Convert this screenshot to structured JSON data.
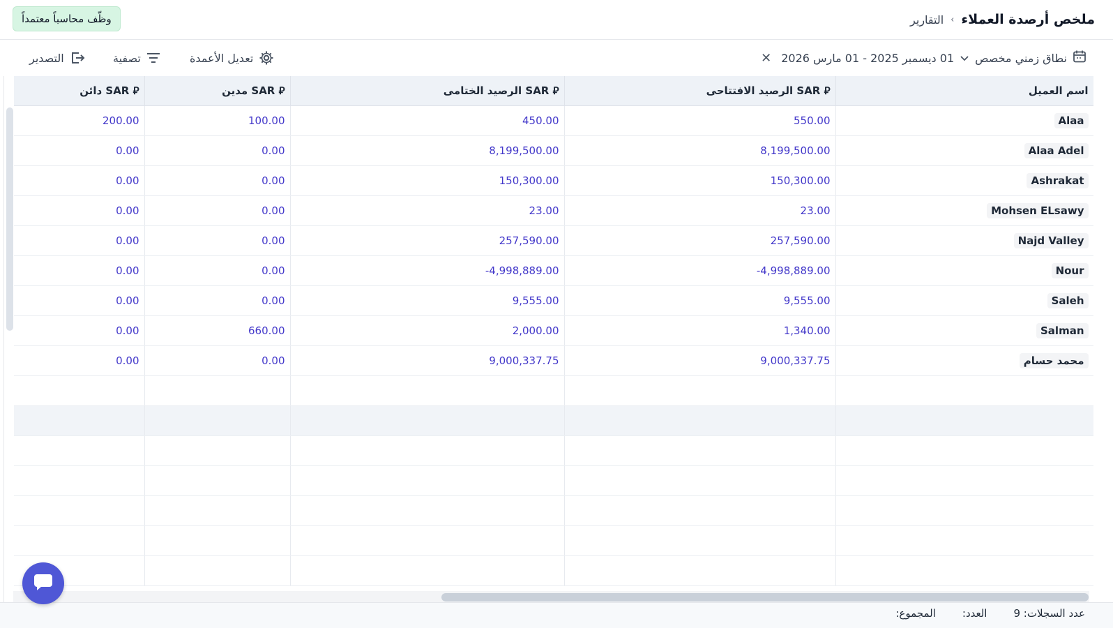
{
  "breadcrumb": {
    "parent": "التقارير",
    "separator": "›",
    "title": "ملخص أرصدة العملاء"
  },
  "cta_label": "وظّف محاسباً معتمداً",
  "toolbar": {
    "date_range_label": "نطاق زمني مخصص",
    "date_range_value": "01 ديسمبر 2025 - 01 مارس 2026",
    "edit_columns": "تعديل الأعمدة",
    "filter": "تصفية",
    "export": "التصدير"
  },
  "columns": {
    "customer": "اسم العميل",
    "opening": "الرصيد الافتتاحى SAR ⃁",
    "closing": "الرصيد الختامى SAR ⃁",
    "debit": "مدين SAR ⃁",
    "credit": "دائن SAR ⃁"
  },
  "rows": [
    {
      "name": "Alaa",
      "opening": "550.00",
      "closing": "450.00",
      "debit": "100.00",
      "credit": "200.00"
    },
    {
      "name": "Alaa Adel",
      "opening": "8,199,500.00",
      "closing": "8,199,500.00",
      "debit": "0.00",
      "credit": "0.00"
    },
    {
      "name": "Ashrakat",
      "opening": "150,300.00",
      "closing": "150,300.00",
      "debit": "0.00",
      "credit": "0.00"
    },
    {
      "name": "Mohsen ELsawy",
      "opening": "23.00",
      "closing": "23.00",
      "debit": "0.00",
      "credit": "0.00"
    },
    {
      "name": "Najd Valley",
      "opening": "257,590.00",
      "closing": "257,590.00",
      "debit": "0.00",
      "credit": "0.00"
    },
    {
      "name": "Nour",
      "opening": "-4,998,889.00",
      "closing": "-4,998,889.00",
      "debit": "0.00",
      "credit": "0.00"
    },
    {
      "name": "Saleh",
      "opening": "9,555.00",
      "closing": "9,555.00",
      "debit": "0.00",
      "credit": "0.00"
    },
    {
      "name": "Salman",
      "opening": "1,340.00",
      "closing": "2,000.00",
      "debit": "660.00",
      "credit": "0.00"
    },
    {
      "name": "محمد حسام",
      "opening": "9,000,337.75",
      "closing": "9,000,337.75",
      "debit": "0.00",
      "credit": "0.00"
    }
  ],
  "footer": {
    "records": "عدد السجلات: 9",
    "count": "العدد:",
    "total": "المجموع:"
  },
  "icons": {
    "calendar": "calendar-icon",
    "chevron": "chevron-down-icon",
    "clear": "close-icon",
    "gear": "gear-icon",
    "filter": "filter-icon",
    "export": "export-icon",
    "chat": "chat-icon"
  },
  "colors": {
    "accent": "#4f57d6",
    "value_text": "#4338ca",
    "cta_bg": "#d7f5e3",
    "header_bg": "#eef2f7"
  }
}
